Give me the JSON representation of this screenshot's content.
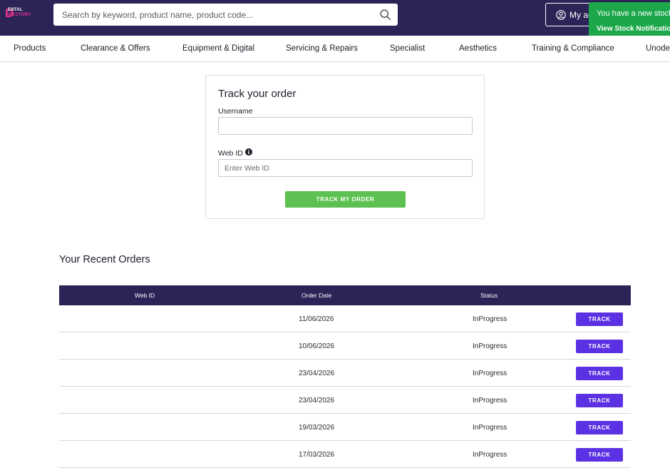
{
  "header": {
    "logo_line1": "ENTAL",
    "logo_line2": "IRECTORY",
    "logo_mark": "D",
    "search_placeholder": "Search by keyword, product name, product code...",
    "search_icon": "search-icon",
    "account_label": "My account",
    "toast_title": "You have a new stock",
    "toast_link": "View Stock Notifications"
  },
  "nav": {
    "items": [
      "Products",
      "Clearance & Offers",
      "Equipment & Digital",
      "Servicing & Repairs",
      "Specialist",
      "Aesthetics",
      "Training & Compliance",
      "Unodent"
    ]
  },
  "track": {
    "title": "Track your order",
    "username_label": "Username",
    "username_value": "",
    "webid_label": "Web ID",
    "webid_placeholder": "Enter Web ID",
    "button": "TRACK MY ORDER"
  },
  "recent": {
    "title": "Your Recent Orders",
    "columns": [
      "Web ID",
      "Order Date",
      "Status"
    ],
    "track_label": "TRACK",
    "rows": [
      {
        "web_id": "",
        "date": "11/06/2026",
        "status": "InProgress"
      },
      {
        "web_id": "",
        "date": "10/06/2026",
        "status": "InProgress"
      },
      {
        "web_id": "",
        "date": "23/04/2026",
        "status": "InProgress"
      },
      {
        "web_id": "",
        "date": "23/04/2026",
        "status": "InProgress"
      },
      {
        "web_id": "",
        "date": "19/03/2026",
        "status": "InProgress"
      },
      {
        "web_id": "",
        "date": "17/03/2026",
        "status": "InProgress"
      }
    ]
  },
  "colors": {
    "header_bg": "#2c2357",
    "brand_pink": "#e8308a",
    "toast_green": "#1ba74a",
    "track_green": "#5cc150",
    "track_purple": "#5b31e3"
  }
}
